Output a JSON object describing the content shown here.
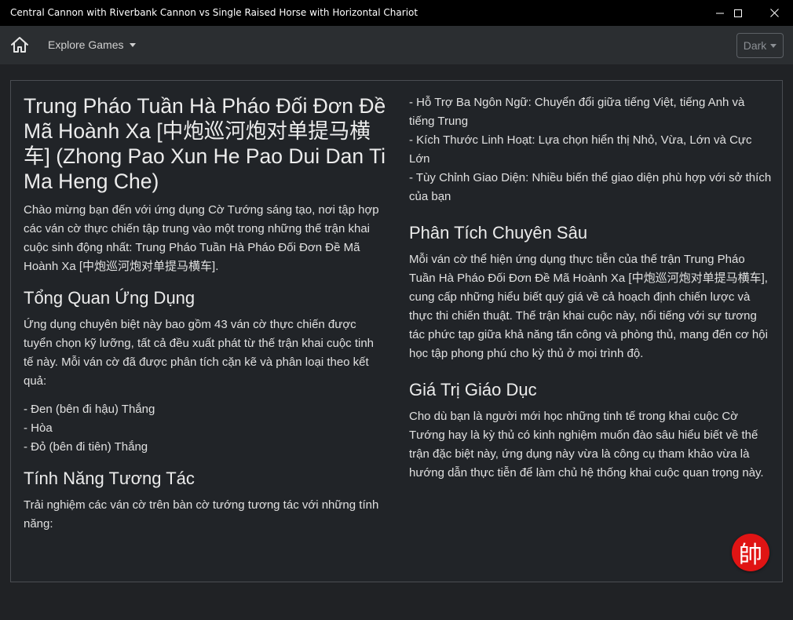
{
  "window": {
    "title": "Central Cannon with Riverbank Cannon vs Single Raised Horse with Horizontal Chariot"
  },
  "navbar": {
    "explore_label": "Explore Games",
    "theme_label": "Dark"
  },
  "content": {
    "title": "Trung Pháo Tuần Hà Pháo Đối Đơn Đề Mã Hoành Xa [中炮巡河炮对单提马横车] (Zhong Pao Xun He Pao Dui Dan Ti Ma Heng Che)",
    "intro": "Chào mừng bạn đến với ứng dụng Cờ Tướng sáng tạo, nơi tập hợp các ván cờ thực chiến tập trung vào một trong những thế trận khai cuộc sinh động nhất: Trung Pháo Tuần Hà Pháo Đối Đơn Đề Mã Hoành Xa [中炮巡河炮对单提马横车].",
    "overview_heading": "Tổng Quan Ứng Dụng",
    "overview_text": "Ứng dụng chuyên biệt này bao gồm 43 ván cờ thực chiến được tuyển chọn kỹ lưỡng, tất cả đều xuất phát từ thế trận khai cuộc tinh tế này. Mỗi ván cờ đã được phân tích cặn kẽ và phân loại theo kết quả:",
    "results": [
      "- Đen (bên đi hậu) Thắng",
      "- Hòa",
      "- Đỏ (bên đi tiên) Thắng"
    ],
    "features_heading": "Tính Năng Tương Tác",
    "features_text": "Trải nghiệm các ván cờ trên bàn cờ tướng tương tác với những tính năng:",
    "features": [
      "- Hỗ Trợ Ba Ngôn Ngữ: Chuyển đổi giữa tiếng Việt, tiếng Anh và tiếng Trung",
      "- Kích Thước Linh Hoạt: Lựa chọn hiển thị Nhỏ, Vừa, Lớn và Cực Lớn",
      "- Tùy Chỉnh Giao Diện: Nhiều biến thể giao diện phù hợp với sở thích của bạn"
    ],
    "analysis_heading": "Phân Tích Chuyên Sâu",
    "analysis_text": "Mỗi ván cờ thể hiện ứng dụng thực tiễn của thế trận Trung Pháo Tuần Hà Pháo Đối Đơn Đề Mã Hoành Xa [中炮巡河炮对单提马横车], cung cấp những hiểu biết quý giá về cả hoạch định chiến lược và thực thi chiến thuật. Thế trận khai cuộc này, nổi tiếng với sự tương tác phức tạp giữa khả năng tấn công và phòng thủ, mang đến cơ hội học tập phong phú cho kỳ thủ ở mọi trình độ.",
    "education_heading": "Giá Trị Giáo Dục",
    "education_text": "Cho dù bạn là người mới học những tinh tế trong khai cuộc Cờ Tướng hay là kỳ thủ có kinh nghiệm muốn đào sâu hiểu biết về thế trận đặc biệt này, ứng dụng này vừa là công cụ tham khảo vừa là hướng dẫn thực tiễn để làm chủ hệ thống khai cuộc quan trọng này."
  },
  "badge": {
    "glyph": "帥",
    "color": "#e01414"
  },
  "icons": {
    "home": "home-icon",
    "minimize": "minimize-icon",
    "maximize": "maximize-icon",
    "close": "close-icon"
  }
}
